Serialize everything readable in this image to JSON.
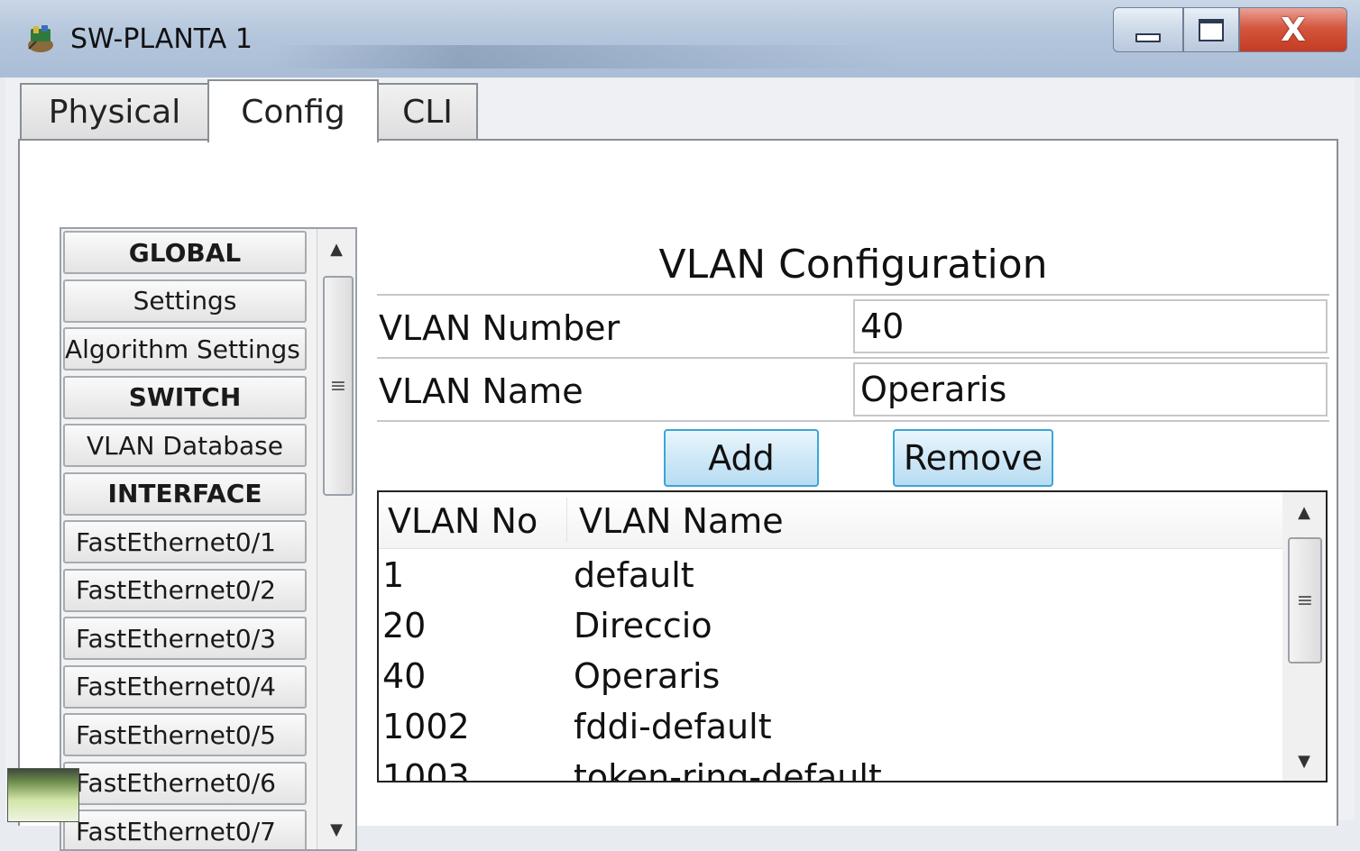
{
  "window": {
    "title": "SW-PLANTA 1",
    "icon": "packet-tracer-switch-icon",
    "controls": {
      "minimize": "minimize-icon",
      "maximize": "maximize-icon",
      "close_label": "X"
    }
  },
  "tabs": [
    {
      "label": "Physical",
      "active": false
    },
    {
      "label": "Config",
      "active": true
    },
    {
      "label": "CLI",
      "active": false
    }
  ],
  "sidebar": {
    "items": [
      {
        "label": "GLOBAL",
        "type": "header"
      },
      {
        "label": "Settings",
        "type": "item"
      },
      {
        "label": "Algorithm Settings",
        "type": "item"
      },
      {
        "label": "SWITCH",
        "type": "header"
      },
      {
        "label": "VLAN Database",
        "type": "item"
      },
      {
        "label": "INTERFACE",
        "type": "header"
      },
      {
        "label": "FastEthernet0/1",
        "type": "port"
      },
      {
        "label": "FastEthernet0/2",
        "type": "port"
      },
      {
        "label": "FastEthernet0/3",
        "type": "port"
      },
      {
        "label": "FastEthernet0/4",
        "type": "port"
      },
      {
        "label": "FastEthernet0/5",
        "type": "port"
      },
      {
        "label": "FastEthernet0/6",
        "type": "port"
      },
      {
        "label": "FastEthernet0/7",
        "type": "port"
      }
    ]
  },
  "vlan_config": {
    "title": "VLAN Configuration",
    "number_label": "VLAN Number",
    "number_value": "40",
    "name_label": "VLAN Name",
    "name_value": "Operaris",
    "add_label": "Add",
    "remove_label": "Remove",
    "table": {
      "columns": [
        "VLAN No",
        "VLAN Name"
      ],
      "rows": [
        [
          "1",
          "default"
        ],
        [
          "20",
          "Direccio"
        ],
        [
          "40",
          "Operaris"
        ],
        [
          "1002",
          "fddi-default"
        ],
        [
          "1003",
          "token-ring-default"
        ]
      ]
    }
  },
  "colors": {
    "accent_button_border": "#3aa6d8",
    "close_button": "#c43b22"
  }
}
